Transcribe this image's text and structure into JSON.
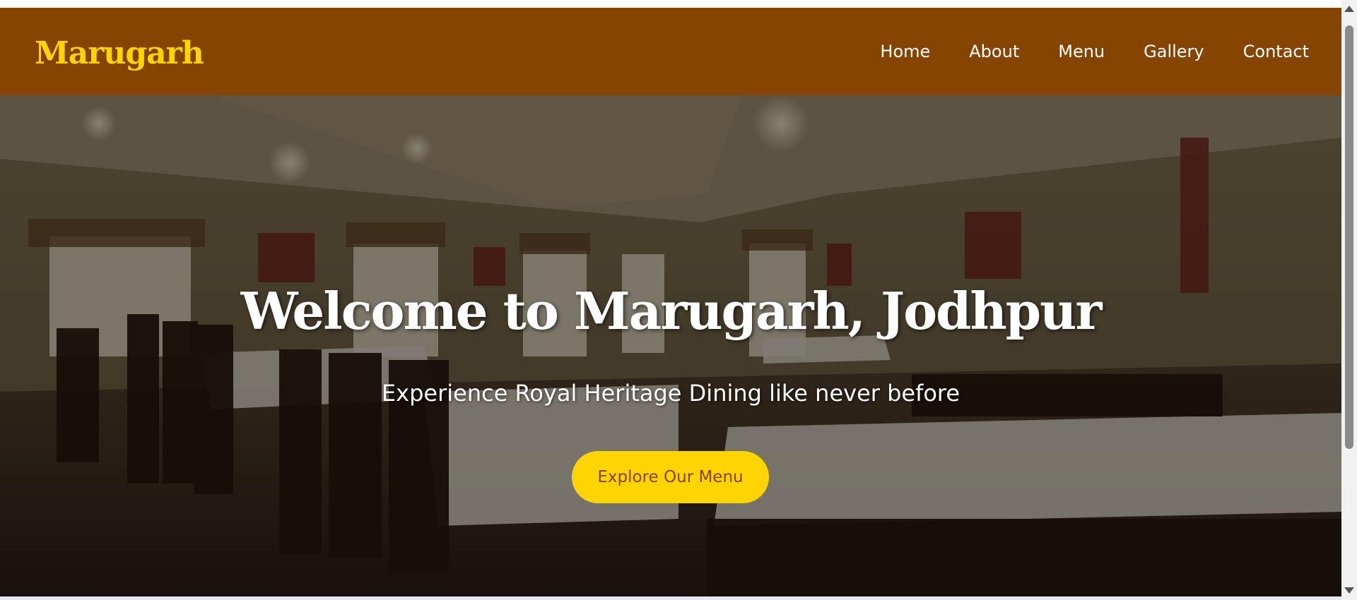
{
  "navbar": {
    "brand": "Marugarh",
    "links": [
      {
        "label": "Home"
      },
      {
        "label": "About"
      },
      {
        "label": "Menu"
      },
      {
        "label": "Gallery"
      },
      {
        "label": "Contact"
      }
    ]
  },
  "hero": {
    "title": "Welcome to Marugarh, Jodhpur",
    "subtitle": "Experience Royal Heritage Dining like never before",
    "cta_label": "Explore Our Menu",
    "background_image": "restaurant-dining-hall-photo"
  },
  "colors": {
    "navbar_bg": "#854400",
    "brand": "#ffd400",
    "nav_link": "#ffffff",
    "cta_bg": "#ffd400",
    "cta_text": "#854400",
    "hero_text": "#ffffff"
  }
}
